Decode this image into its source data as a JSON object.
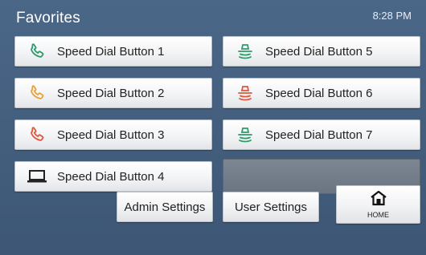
{
  "header": {
    "title": "Favorites",
    "time": "8:28 PM"
  },
  "speed_dials": [
    {
      "label": "Speed Dial Button 1",
      "icon": "phone-icon",
      "color": "#2e9a6a"
    },
    {
      "label": "Speed Dial Button 2",
      "icon": "phone-icon",
      "color": "#e8a23a"
    },
    {
      "label": "Speed Dial Button 3",
      "icon": "phone-icon",
      "color": "#e0573c"
    },
    {
      "label": "Speed Dial Button 4",
      "icon": "laptop-icon",
      "color": "#222222"
    },
    {
      "label": "Speed Dial Button 5",
      "icon": "conference-phone-icon",
      "color": "#2e9a6a"
    },
    {
      "label": "Speed Dial Button 6",
      "icon": "conference-phone-icon",
      "color": "#e0573c"
    },
    {
      "label": "Speed Dial Button 7",
      "icon": "conference-phone-icon",
      "color": "#2e9a6a"
    }
  ],
  "footer": {
    "admin_label": "Admin Settings",
    "user_label": "User Settings",
    "home_label": "HOME"
  }
}
